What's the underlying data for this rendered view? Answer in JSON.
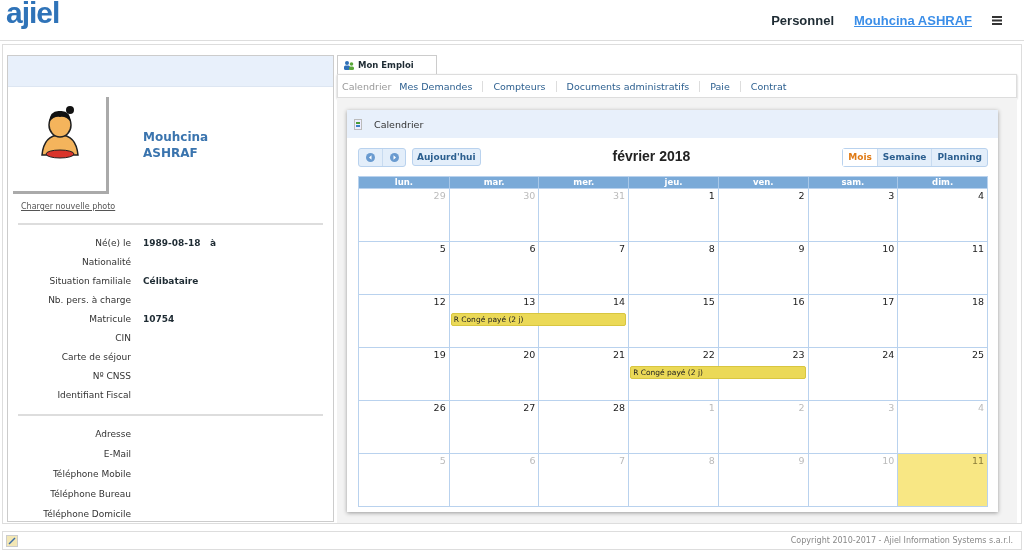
{
  "header": {
    "logo": "ajiel",
    "section": "Personnel",
    "user_link": "Mouhcina ASHRAF"
  },
  "profile": {
    "name_first": "Mouhcina",
    "name_last": "ASHRAF",
    "photo_link": "Charger nouvelle photo",
    "identity": [
      {
        "label": "Né(e) le",
        "value": "1989-08-18   à"
      },
      {
        "label": "Nationalité"
      },
      {
        "label": "Situation familiale",
        "value": "Célibataire"
      },
      {
        "label": "Nb. pers. à charge"
      },
      {
        "label": "Matricule",
        "value": "10754"
      },
      {
        "label": "CIN"
      },
      {
        "label": "Carte de séjour"
      },
      {
        "label": "Nº CNSS"
      },
      {
        "label": "Identifiant Fiscal"
      }
    ],
    "contact": [
      {
        "label": "Adresse"
      },
      {
        "label": "E-Mail"
      },
      {
        "label": "Téléphone Mobile"
      },
      {
        "label": "Téléphone Bureau"
      },
      {
        "label": "Téléphone Domicile"
      }
    ]
  },
  "main_tab": {
    "label": "Mon Emploi",
    "selected": true
  },
  "subnav": [
    {
      "label": "Calendrier",
      "selected": true
    },
    {
      "label": "Mes Demandes",
      "selected": false
    },
    {
      "label": "Compteurs",
      "selected": false
    },
    {
      "label": "Documents administratifs",
      "selected": false
    },
    {
      "label": "Paie",
      "selected": false
    },
    {
      "label": "Contrat",
      "selected": false
    }
  ],
  "calendar": {
    "panel_title": "Calendrier",
    "today_button": "Aujourd'hui",
    "month_title": "février 2018",
    "views": [
      {
        "label": "Mois",
        "selected": true
      },
      {
        "label": "Semaine",
        "selected": false
      },
      {
        "label": "Planning",
        "selected": false
      }
    ],
    "weekdays": [
      "lun.",
      "mar.",
      "mer.",
      "jeu.",
      "ven.",
      "sam.",
      "dim."
    ],
    "weeks": [
      {
        "days": [
          {
            "day": "29",
            "other_month": true
          },
          {
            "day": "30",
            "other_month": true
          },
          {
            "day": "31",
            "other_month": true
          },
          {
            "day": "1",
            "other_month": false
          },
          {
            "day": "2",
            "other_month": false
          },
          {
            "day": "3",
            "other_month": false
          },
          {
            "day": "4",
            "other_month": false
          }
        ]
      },
      {
        "days": [
          {
            "day": "5",
            "other_month": false
          },
          {
            "day": "6",
            "other_month": false
          },
          {
            "day": "7",
            "other_month": false
          },
          {
            "day": "8",
            "other_month": false
          },
          {
            "day": "9",
            "other_month": false
          },
          {
            "day": "10",
            "other_month": false
          },
          {
            "day": "11",
            "other_month": false
          }
        ]
      },
      {
        "days": [
          {
            "day": "12",
            "other_month": false
          },
          {
            "day": "13",
            "other_month": false,
            "event": "R Congé payé (2 j)"
          },
          {
            "day": "14",
            "other_month": false,
            "event_continued": true
          },
          {
            "day": "15",
            "other_month": false
          },
          {
            "day": "16",
            "other_month": false
          },
          {
            "day": "17",
            "other_month": false
          },
          {
            "day": "18",
            "other_month": false
          }
        ]
      },
      {
        "days": [
          {
            "day": "19",
            "other_month": false
          },
          {
            "day": "20",
            "other_month": false
          },
          {
            "day": "21",
            "other_month": false
          },
          {
            "day": "22",
            "other_month": false,
            "event": "R Congé payé (2 j)"
          },
          {
            "day": "23",
            "other_month": false,
            "event_continued": true
          },
          {
            "day": "24",
            "other_month": false
          },
          {
            "day": "25",
            "other_month": false
          }
        ]
      },
      {
        "days": [
          {
            "day": "26",
            "other_month": false
          },
          {
            "day": "27",
            "other_month": false
          },
          {
            "day": "28",
            "other_month": false
          },
          {
            "day": "1",
            "other_month": true
          },
          {
            "day": "2",
            "other_month": true
          },
          {
            "day": "3",
            "other_month": true
          },
          {
            "day": "4",
            "other_month": true
          }
        ]
      },
      {
        "days": [
          {
            "day": "5",
            "other_month": true
          },
          {
            "day": "6",
            "other_month": true
          },
          {
            "day": "7",
            "other_month": true
          },
          {
            "day": "8",
            "other_month": true
          },
          {
            "day": "9",
            "other_month": true
          },
          {
            "day": "10",
            "other_month": true
          },
          {
            "day": "11",
            "other_month": true,
            "today": true
          }
        ]
      }
    ]
  },
  "footer": {
    "copyright": "Copyright 2010-2017 - Ajiel Information Systems s.a.r.l."
  }
}
